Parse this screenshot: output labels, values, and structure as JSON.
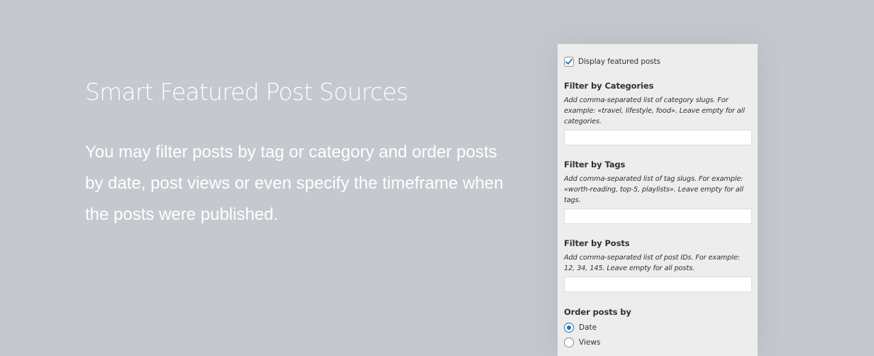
{
  "hero": {
    "title": "Smart Featured Post Sources",
    "description": "You may filter posts by tag or category and order posts by date, post views or even specify the timeframe when the posts were published."
  },
  "panel": {
    "display_featured": {
      "label": "Display featured posts",
      "checked": true
    },
    "filter_categories": {
      "title": "Filter by Categories",
      "help": "Add comma-separated list of category slugs. For example: «travel, lifestyle, food». Leave empty for all categories.",
      "value": ""
    },
    "filter_tags": {
      "title": "Filter by Tags",
      "help": "Add comma-separated list of tag slugs. For example: «worth-reading, top-5, playlists». Leave empty for all tags.",
      "value": ""
    },
    "filter_posts": {
      "title": "Filter by Posts",
      "help": "Add comma-separated list of post IDs. For example: 12, 34, 145. Leave empty for all posts.",
      "value": ""
    },
    "order": {
      "title": "Order posts by",
      "options": [
        {
          "label": "Date",
          "checked": true
        },
        {
          "label": "Views",
          "checked": false
        }
      ]
    }
  },
  "colors": {
    "background": "#c5c8ce",
    "panel": "#ededed",
    "accent": "#2271b1",
    "text": "#2c3338"
  },
  "icons": {
    "checkbox_checked": "checkmark-icon"
  }
}
